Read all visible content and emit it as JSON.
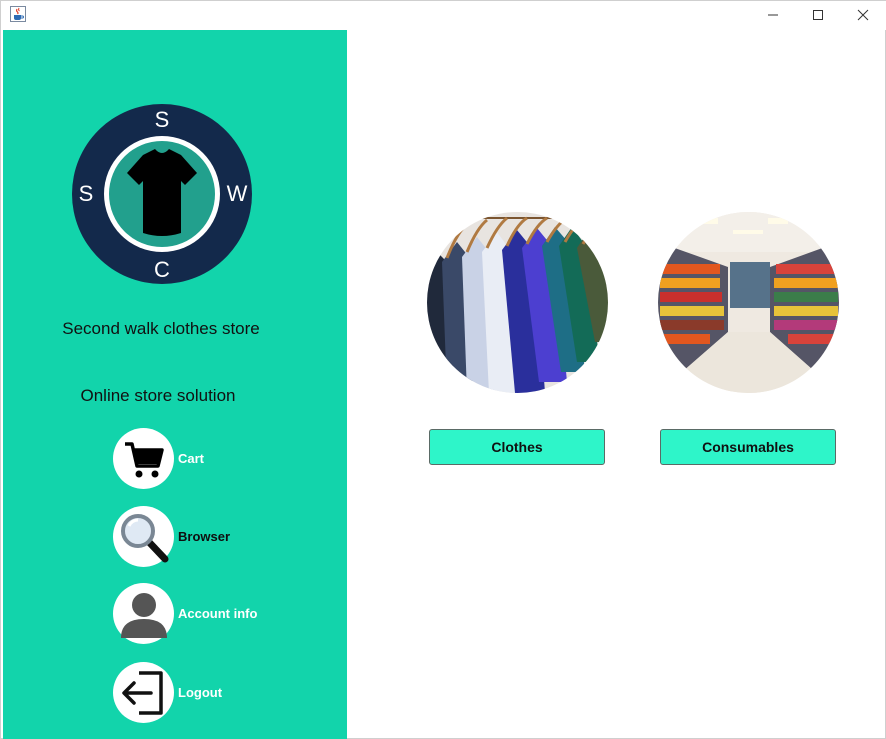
{
  "window": {
    "icons": {
      "app": "java-cup-icon",
      "minimize": "minimize-icon",
      "maximize": "maximize-icon",
      "close": "close-icon"
    }
  },
  "sidebar": {
    "logo": {
      "letters": {
        "top": "S",
        "left": "S",
        "right": "W",
        "bottom": "C"
      },
      "icon": "tshirt-icon"
    },
    "store_name": "Second walk clothes store",
    "tagline": "Online store solution",
    "nav": [
      {
        "label": "Cart",
        "icon": "cart-icon"
      },
      {
        "label": "Browser",
        "icon": "magnifier-icon"
      },
      {
        "label": "Account info",
        "icon": "user-icon"
      },
      {
        "label": "Logout",
        "icon": "logout-icon"
      }
    ]
  },
  "main": {
    "categories": [
      {
        "label": "Clothes",
        "image": "clothes-rack-image"
      },
      {
        "label": "Consumables",
        "image": "supermarket-aisle-image"
      }
    ]
  },
  "colors": {
    "sidebar": "#12d4ab",
    "button": "#2ef5c9",
    "logo_ring": "#13294b",
    "logo_inner": "#22a08d"
  }
}
